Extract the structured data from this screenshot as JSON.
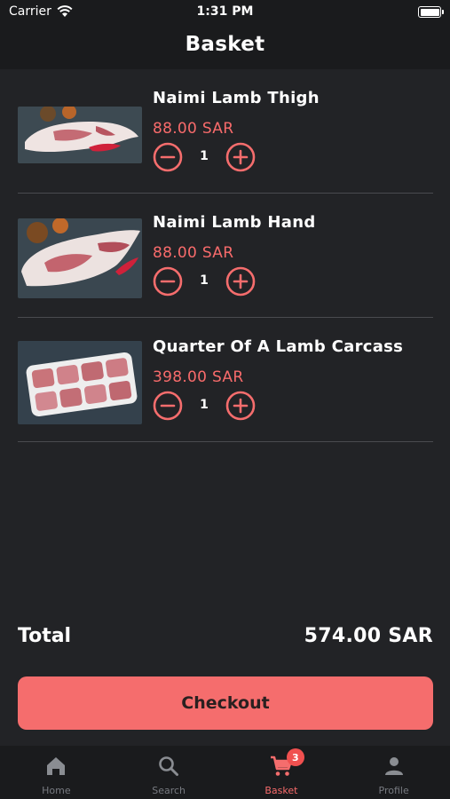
{
  "status_bar": {
    "carrier": "Carrier",
    "time": "1:31 PM"
  },
  "header": {
    "title": "Basket"
  },
  "items": [
    {
      "name": "Naimi Lamb Thigh",
      "price": "88.00 SAR",
      "quantity": "1"
    },
    {
      "name": "Naimi Lamb Hand",
      "price": "88.00 SAR",
      "quantity": "1"
    },
    {
      "name": "Quarter Of A Lamb Carcass",
      "price": "398.00 SAR",
      "quantity": "1"
    }
  ],
  "summary": {
    "total_label": "Total",
    "total_value": "574.00 SAR"
  },
  "checkout": {
    "label": "Checkout"
  },
  "tabs": [
    {
      "label": "Home",
      "icon": "home-icon"
    },
    {
      "label": "Search",
      "icon": "search-icon"
    },
    {
      "label": "Basket",
      "icon": "cart-icon",
      "badge": "3",
      "active": true
    },
    {
      "label": "Profile",
      "icon": "person-icon"
    }
  ],
  "colors": {
    "accent": "#f56d6d",
    "price": "#f86b6b",
    "background": "#222326",
    "bar": "#1a1b1d"
  }
}
